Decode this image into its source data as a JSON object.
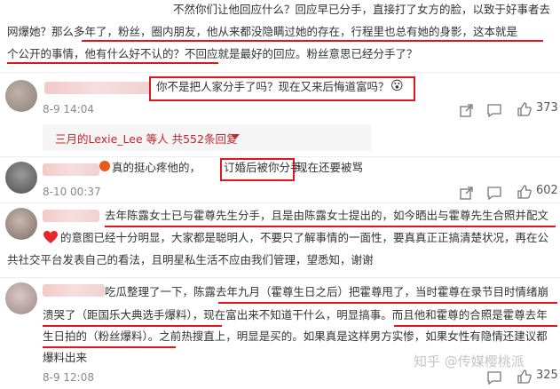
{
  "comments": [
    {
      "lines": [
        "不然你们让他回应什么？回应早已分手，直接打了女方的脸，以致于好事者去",
        "网爆她？那么多年了，粉丝，圈内朋友，他从来都没隐瞒过她的存在，行程里也总有她的身影，这本就是",
        "个公开的事情，他有什么好不认的？不回应就是最好的回应。粉丝意思已经分手了？"
      ]
    },
    {
      "text": "你不是把人家分手了吗？现在又来后悔道富吗？",
      "emoji": "😮",
      "date": "8-9 14:04",
      "likes": "373",
      "replies_header": "三月的Lexie_Lee 等人 共552条回复",
      "replies_icon": "chevron-down"
    },
    {
      "prefix": "真的挺心疼他的，",
      "boxed": "订婚后被你分手，",
      "suffix": "现在还要被骂",
      "date": "8-10 00:37",
      "likes": "602"
    },
    {
      "lines": [
        "去年陈露女士已与霍尊先生分手，且是由陈露女士提出的，如今晒出与霍尊先生合照并配文",
        "的意图已经十分明显，大家都是聪明人，不要只了解事情的一面性，要真真正正搞清楚状况，再在公",
        "共社交平台发表自己的看法，且明星私生活不应由我们管理，望悉知，谢谢"
      ]
    },
    {
      "lines": [
        "吃瓜整理了一下，陈露去年九月（霍尊生日之后）把霍尊甩了，当时霍尊在录节目时情绪崩",
        "溃哭了（距国乐大典选手爆料），现在富出来不知道干什么，明显搞事。而且他和霍尊的合照是霍尊去年",
        "生日拍的（粉丝爆料）。之前热搜直上，明显是买的。如果真是这样男方实惨，如果女性有隐情还建议都",
        "爆料出来"
      ],
      "date": "8-9 12:08",
      "likes": "325"
    }
  ],
  "watermark": "知乎 @传媒樱桃派"
}
